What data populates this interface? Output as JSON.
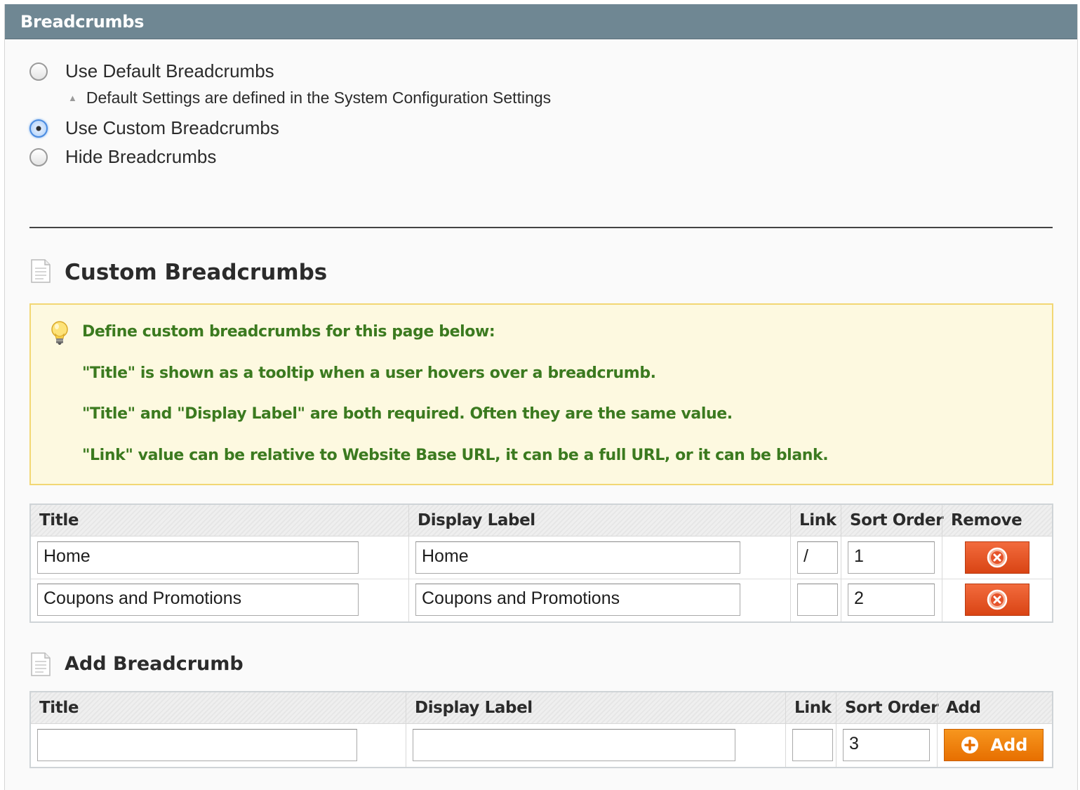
{
  "panel": {
    "title": "Breadcrumbs"
  },
  "options": {
    "use_default": "Use Default Breadcrumbs",
    "default_note": "Default Settings are defined in the System Configuration Settings",
    "use_custom": "Use Custom Breadcrumbs",
    "hide": "Hide Breadcrumbs",
    "selected": "use_custom"
  },
  "custom": {
    "title": "Custom Breadcrumbs",
    "tips": [
      "Define custom breadcrumbs for this page below:",
      "\"Title\" is shown as a tooltip when a user hovers over a breadcrumb.",
      "\"Title\" and \"Display Label\" are both required. Often they are the same value.",
      "\"Link\" value can be relative to Website Base URL, it can be a full URL, or it can be blank."
    ],
    "columns": {
      "title": "Title",
      "display_label": "Display Label",
      "link": "Link",
      "sort_order": "Sort Order",
      "remove": "Remove"
    },
    "rows": [
      {
        "title": "Home",
        "display_label": "Home",
        "link": "/",
        "sort_order": "1"
      },
      {
        "title": "Coupons and Promotions",
        "display_label": "Coupons and Promotions",
        "link": "",
        "sort_order": "2"
      }
    ]
  },
  "add": {
    "title": "Add Breadcrumb",
    "columns": {
      "title": "Title",
      "display_label": "Display Label",
      "link": "Link",
      "sort_order": "Sort Order",
      "add": "Add"
    },
    "row": {
      "title": "",
      "display_label": "",
      "link": "",
      "sort_order": "3"
    },
    "button_label": "Add"
  },
  "colors": {
    "header": "#6f8793",
    "tip_text": "#3b7a1f",
    "remove_button": "#e0521f",
    "add_button": "#f08512"
  }
}
